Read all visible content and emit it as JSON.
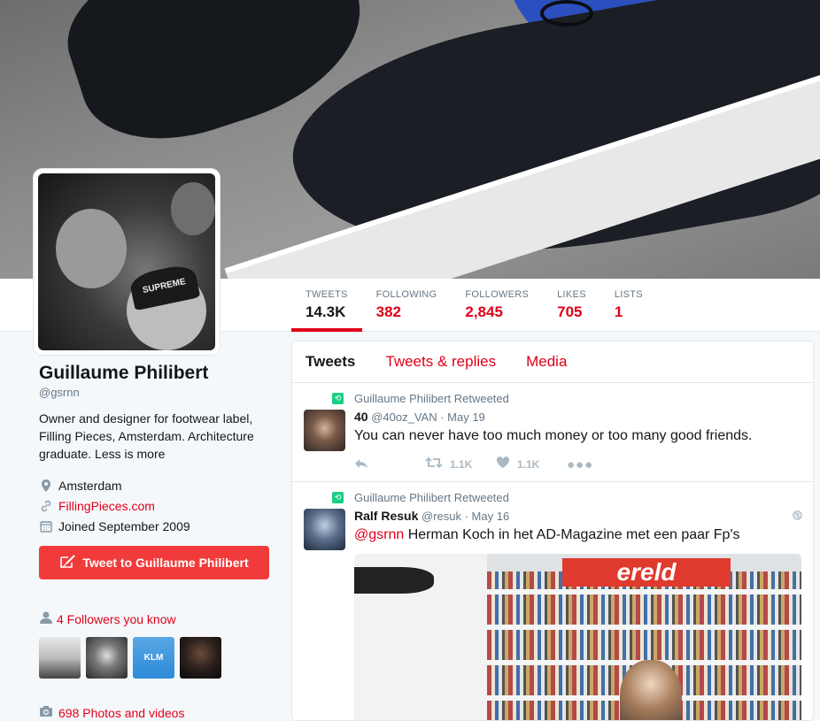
{
  "profile": {
    "name": "Guillaume Philibert",
    "handle": "@gsrnn",
    "bio": "Owner and designer for footwear label, Filling Pieces, Amsterdam. Architecture graduate. Less is more",
    "location": "Amsterdam",
    "website": "FillingPieces.com",
    "joined": "Joined September 2009",
    "tweet_to_label": "Tweet to Guillaume Philibert",
    "followers_you_know": "4 Followers you know",
    "photos_videos": "698 Photos and videos",
    "avatar_cap_text": "SUPREME"
  },
  "stats": [
    {
      "label": "TWEETS",
      "value": "14.3K",
      "active": true
    },
    {
      "label": "FOLLOWING",
      "value": "382",
      "active": false
    },
    {
      "label": "FOLLOWERS",
      "value": "2,845",
      "active": false
    },
    {
      "label": "LIKES",
      "value": "705",
      "active": false
    },
    {
      "label": "LISTS",
      "value": "1",
      "active": false
    }
  ],
  "timeline": {
    "tabs": [
      "Tweets",
      "Tweets & replies",
      "Media"
    ],
    "tweets": [
      {
        "retweet_line": "Guillaume Philibert Retweeted",
        "author_name": "40",
        "author_handle": "@40oz_VAN",
        "date": "· May 19",
        "text": "You can never have too much money or too many good friends.",
        "retweets": "1.1K",
        "likes": "1.1K"
      },
      {
        "retweet_line": "Guillaume Philibert Retweeted",
        "author_name": "Ralf Resuk",
        "author_handle": "@resuk",
        "date": "· May 16",
        "mention": "@gsrnn",
        "text": " Herman Koch in het AD-Magazine met een paar Fp's",
        "image_headline": "ereld"
      }
    ]
  },
  "thumb_klm": "KLM",
  "colors": {
    "accent": "#e0001a",
    "tweet_button": "#f13b3b",
    "retweet_green": "#19cf86"
  }
}
